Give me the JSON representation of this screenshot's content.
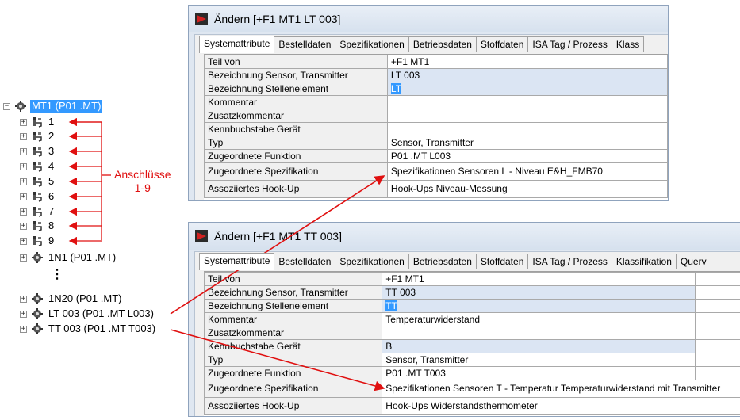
{
  "tree": {
    "root_label": "MT1 (P01 .MT)",
    "numbered_children": [
      "1",
      "2",
      "3",
      "4",
      "5",
      "6",
      "7",
      "8",
      "9"
    ],
    "others_before_gap": [
      "1N1 (P01 .MT)"
    ],
    "ellipsis": "⋮",
    "others_after_gap": [
      "1N20 (P01 .MT)",
      "LT 003 (P01 .MT L003)",
      "TT 003 (P01 .MT T003)"
    ],
    "expander_symbol": "+",
    "collapse_symbol": "−"
  },
  "annotation": {
    "line1": "Anschlüsse",
    "line2": "1-9",
    "color": "#e01010"
  },
  "dialog1": {
    "title": "Ändern [+F1 MT1 LT 003]",
    "tabs": [
      "Systemattribute",
      "Bestelldaten",
      "Spezifikationen",
      "Betriebsdaten",
      "Stoffdaten",
      "ISA Tag / Prozess",
      "Klass"
    ],
    "rows": [
      {
        "label": "Teil von",
        "value": "+F1 MT1"
      },
      {
        "label": "Bezeichnung Sensor, Transmitter",
        "value": "LT 003"
      },
      {
        "label": "Bezeichnung Stellenelement",
        "value": "LT"
      },
      {
        "label": "Kommentar",
        "value": ""
      },
      {
        "label": "Zusatzkommentar",
        "value": ""
      },
      {
        "label": "Kennbuchstabe Gerät",
        "value": ""
      },
      {
        "label": "Typ",
        "value": "Sensor, Transmitter"
      },
      {
        "label": "Zugeordnete Funktion",
        "value": "P01 .MT L003"
      },
      {
        "label": "Zugeordnete Spezifikation",
        "value": "Spezifikationen Sensoren L - Niveau E&H_FMB70"
      },
      {
        "label": "Assoziiertes Hook-Up",
        "value": "Hook-Ups Niveau-Messung"
      }
    ]
  },
  "dialog2": {
    "title": "Ändern [+F1 MT1 TT 003]",
    "tabs": [
      "Systemattribute",
      "Bestelldaten",
      "Spezifikationen",
      "Betriebsdaten",
      "Stoffdaten",
      "ISA Tag / Prozess",
      "Klassifikation",
      "Querv"
    ],
    "rows": [
      {
        "label": "Teil von",
        "value": "+F1 MT1"
      },
      {
        "label": "Bezeichnung Sensor, Transmitter",
        "value": "TT 003"
      },
      {
        "label": "Bezeichnung Stellenelement",
        "value": "TT"
      },
      {
        "label": "Kommentar",
        "value": "Temperaturwiderstand"
      },
      {
        "label": "Zusatzkommentar",
        "value": ""
      },
      {
        "label": "Kennbuchstabe Gerät",
        "value": "B"
      },
      {
        "label": "Typ",
        "value": "Sensor, Transmitter"
      },
      {
        "label": "Zugeordnete Funktion",
        "value": "P01 .MT T003"
      },
      {
        "label": "Zugeordnete Spezifikation",
        "value": "Spezifikationen Sensoren T - Temperatur Temperaturwiderstand mit Transmitter"
      },
      {
        "label": "Assoziiertes Hook-Up",
        "value": "Hook-Ups Widerstandsthermometer"
      }
    ]
  },
  "colors": {
    "selection": "#3399ff",
    "arrow": "#e01010",
    "dialog_frame": "#dfe7f1"
  },
  "icons": {
    "tree_root": "gear-device-icon",
    "tree_connector": "connector-plug-icon",
    "dialog": "edit-window-icon"
  }
}
